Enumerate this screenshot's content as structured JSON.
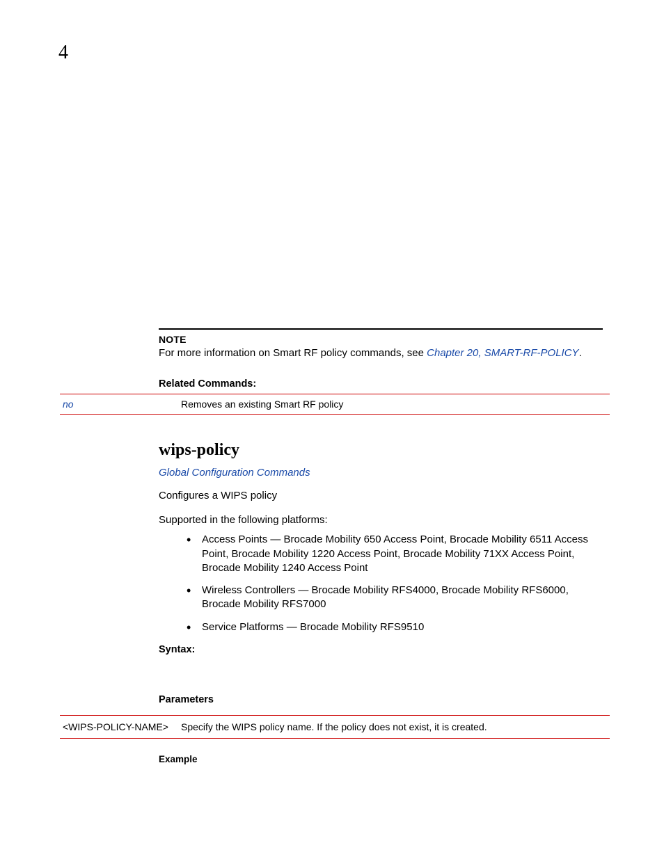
{
  "page_number": "4",
  "note": {
    "label": "NOTE",
    "body_prefix": "For more information on Smart RF policy commands, see ",
    "link": "Chapter 20, SMART-RF-POLICY",
    "body_suffix": "."
  },
  "related": {
    "heading": "Related Commands:",
    "rows": [
      {
        "cmd": "no",
        "desc": "Removes an existing Smart RF policy"
      }
    ]
  },
  "section": {
    "title": "wips-policy",
    "link": "Global Configuration Commands",
    "desc": "Configures a WIPS policy",
    "platforms_intro": "Supported in the following platforms:",
    "platforms": [
      "Access Points — Brocade Mobility 650 Access Point, Brocade Mobility 6511 Access Point, Brocade Mobility 1220 Access Point, Brocade Mobility 71XX Access Point, Brocade Mobility 1240 Access Point",
      "Wireless Controllers — Brocade Mobility RFS4000, Brocade Mobility RFS6000, Brocade Mobility RFS7000",
      "Service Platforms — Brocade Mobility RFS9510"
    ],
    "syntax_label": "Syntax:",
    "parameters_label": "Parameters",
    "params": [
      {
        "name": "<WIPS-POLICY-NAME>",
        "desc": "Specify the WIPS policy name. If the policy does not exist, it is created."
      }
    ],
    "example_label": "Example"
  }
}
